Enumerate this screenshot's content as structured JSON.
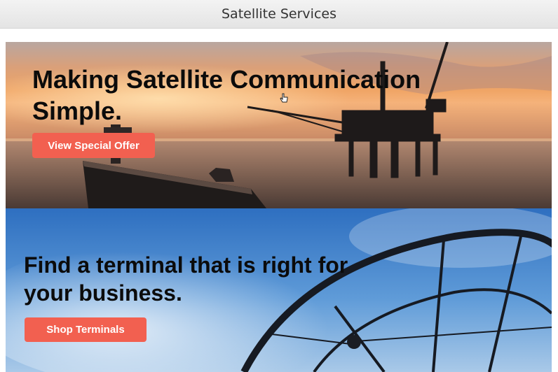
{
  "header": {
    "title": "Satellite Services"
  },
  "banners": [
    {
      "image": "offshore-oil-rig-and-tanker-at-sunset",
      "headline": "Making Satellite Communication Simple.",
      "button_label": "View Special Offer"
    },
    {
      "image": "satellite-dish-against-blue-sky",
      "headline": "Find a terminal that is right for your business.",
      "button_label": "Shop Terminals"
    }
  ],
  "icons": {
    "cursor": "pointer-hand-icon"
  },
  "colors": {
    "cta": "#f26050",
    "sunset": "#e38a52",
    "sky": "#3f7fc8"
  }
}
